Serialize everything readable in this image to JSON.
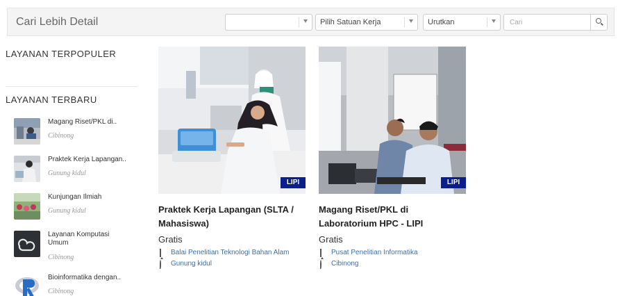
{
  "filter": {
    "title": "Cari Lebih Detail",
    "select1": "",
    "select2": "Pilih Satuan Kerja",
    "select3": "Urutkan",
    "search_placeholder": "Cari"
  },
  "sidebar": {
    "popular_title": "LAYANAN TERPOPULER",
    "newest_title": "LAYANAN TERBARU",
    "items": [
      {
        "title": "Magang Riset/PKL di..",
        "location": "Cibinong"
      },
      {
        "title": "Praktek Kerja Lapangan..",
        "location": "Gunung kidul"
      },
      {
        "title": "Kunjungan Ilmiah",
        "location": "Gunung kidul"
      },
      {
        "title": "Layanan Komputasi Umum",
        "location": "Cibinong"
      },
      {
        "title": "Bioinformatika dengan..",
        "location": "Cibinong"
      }
    ]
  },
  "cards": [
    {
      "badge": "LIPI",
      "title": "Praktek Kerja Lapangan (SLTA / Mahasiswa)",
      "price": "Gratis",
      "unit": "Balai Penelitian Teknologi Bahan Alam",
      "location": "Gunung kidul"
    },
    {
      "badge": "LIPI",
      "title": "Magang Riset/PKL di Laboratorium HPC - LIPI",
      "price": "Gratis",
      "unit": "Pusat Penelitian Informatika",
      "location": "Cibinong"
    }
  ]
}
